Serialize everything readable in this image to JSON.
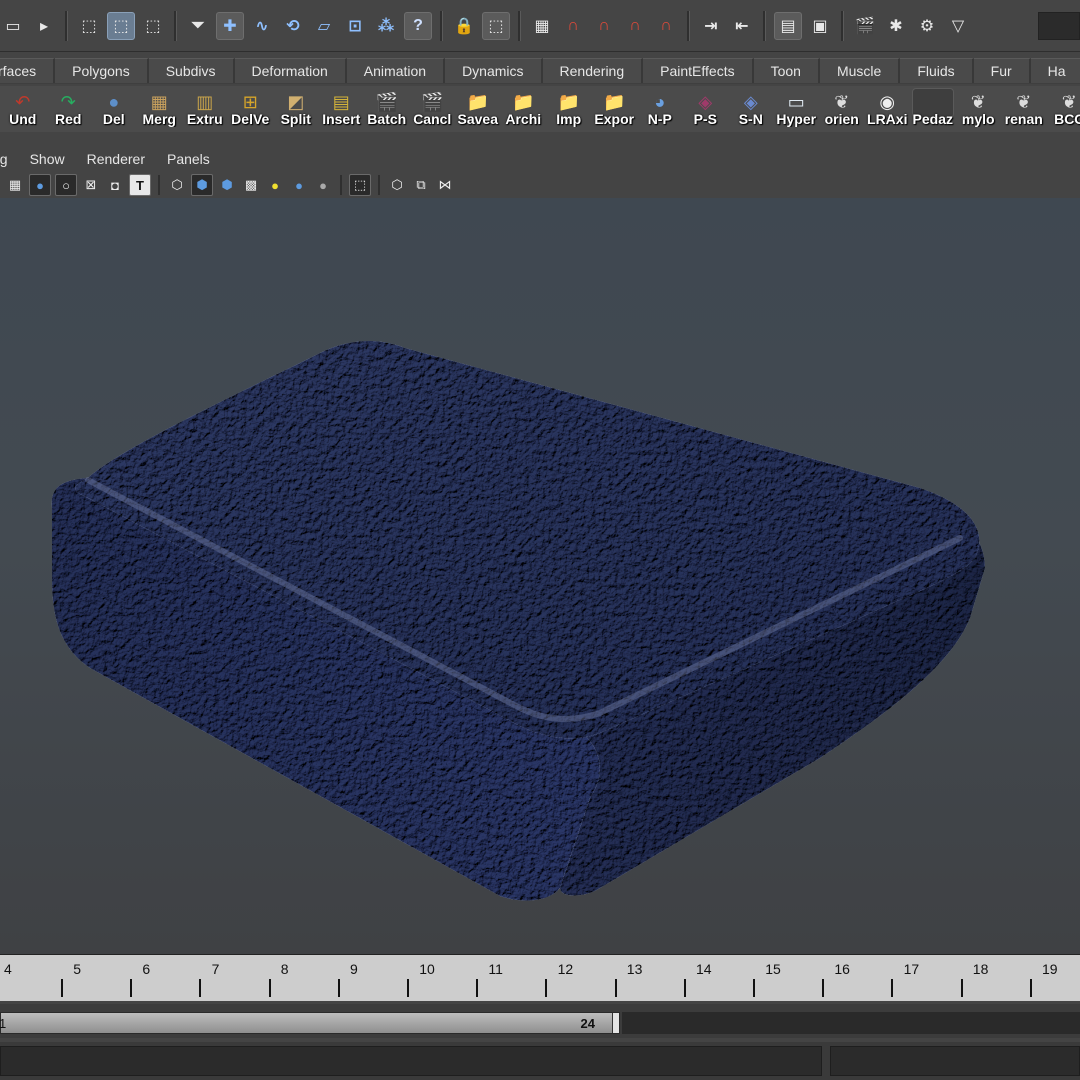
{
  "status_line": {
    "icons": [
      "layout-icon",
      "separator-arrow-icon",
      "select-hierarchy-icon",
      "select-object-icon",
      "select-component-icon",
      "filter-funnel-icon",
      "snap-grid-icon",
      "snap-curve-icon",
      "snap-point-icon",
      "snap-plane-icon",
      "snap-surface-icon",
      "snap-live-icon",
      "help-icon",
      "lock-icon",
      "select-by-type-icon",
      "history-icon",
      "magnet-a-icon",
      "magnet-b-icon",
      "magnet-c-icon",
      "magnet-d-icon",
      "input-ops-icon",
      "output-ops-icon",
      "show-attribute-editor-icon",
      "render-frame-icon",
      "clapboard-icon",
      "ipr-icon",
      "render-settings-icon",
      "expand-icon",
      "input-box-icon"
    ],
    "help_glyph": "?"
  },
  "shelf_tabs": [
    "rfaces",
    "Polygons",
    "Subdivs",
    "Deformation",
    "Animation",
    "Dynamics",
    "Rendering",
    "PaintEffects",
    "Toon",
    "Muscle",
    "Fluids",
    "Fur",
    "Ha"
  ],
  "shelf_buttons": [
    {
      "label": "Und",
      "icon": "undo-arrow-icon",
      "color": "#c0392b"
    },
    {
      "label": "Red",
      "icon": "redo-arrow-icon",
      "color": "#27ae60"
    },
    {
      "label": "Del",
      "icon": "sphere-icon",
      "color": "#5d8fc9"
    },
    {
      "label": "Merg",
      "icon": "merge-mesh-icon",
      "color": "#c9a15d"
    },
    {
      "label": "Extru",
      "icon": "extrude-icon",
      "color": "#caa54b"
    },
    {
      "label": "DelVe",
      "icon": "delete-vertex-icon",
      "color": "#d6a52a"
    },
    {
      "label": "Split",
      "icon": "split-polygon-icon",
      "color": "#d1b070"
    },
    {
      "label": "Insert",
      "icon": "insert-edge-icon",
      "color": "#d3b33a"
    },
    {
      "label": "Batch",
      "icon": "clapboard-icon",
      "color": "#bbbbbb"
    },
    {
      "label": "Cancl",
      "icon": "clapboard-icon",
      "color": "#bbbbbb"
    },
    {
      "label": "Savea",
      "icon": "folder-icon",
      "color": "#e6b93a"
    },
    {
      "label": "Archi",
      "icon": "folder-icon",
      "color": "#e6b93a"
    },
    {
      "label": "Imp",
      "icon": "folder-icon",
      "color": "#e6b93a"
    },
    {
      "label": "Expor",
      "icon": "folder-icon",
      "color": "#e6b93a"
    },
    {
      "label": "N-P",
      "icon": "sphere-globe-icon",
      "color": "#6aa0e0"
    },
    {
      "label": "P-S",
      "icon": "globe-cube-icon",
      "color": "#a03a6a"
    },
    {
      "label": "S-N",
      "icon": "cube-globe-icon",
      "color": "#6a8ad0"
    },
    {
      "label": "Hyper",
      "icon": "hypershade-window-icon",
      "color": "#dfe8f0"
    },
    {
      "label": "orien",
      "icon": "mel-script-icon",
      "color": "#dddddd"
    },
    {
      "label": "LRAxi",
      "icon": "eye-icon",
      "color": "#eeeeee"
    },
    {
      "label": "Pedaz",
      "icon": "blank-icon",
      "color": "#4b4b4b"
    },
    {
      "label": "mylo",
      "icon": "mel-script-icon",
      "color": "#dddddd"
    },
    {
      "label": "renan",
      "icon": "mel-script-icon",
      "color": "#dddddd"
    },
    {
      "label": "BCC",
      "icon": "mel-script-icon",
      "color": "#dddddd"
    }
  ],
  "panel_menu": [
    "ng",
    "Show",
    "Renderer",
    "Panels"
  ],
  "panel_toolbar": {
    "icons": [
      "film-gate-icon",
      "shaded-sphere-icon",
      "wireframe-sphere-icon",
      "grid-toggle-icon",
      "texture-icon",
      "text-icon",
      "wireframe-cube-icon",
      "smooth-shade-cube-icon",
      "flat-shade-cube-icon",
      "checker-cube-icon",
      "default-light-icon",
      "sphere-light-icon",
      "grey-sphere-icon",
      "isolate-select-icon",
      "bounding-box-icon",
      "xray-icon",
      "share-icon"
    ],
    "text_glyph": "T"
  },
  "viewport": {
    "object": "textured-rounded-box-mesh",
    "mesh_color": "#4f5a7c"
  },
  "time_slider": {
    "frames": [
      "4",
      "5",
      "6",
      "7",
      "8",
      "9",
      "10",
      "11",
      "12",
      "13",
      "14",
      "15",
      "16",
      "17",
      "18",
      "19"
    ]
  },
  "range_slider": {
    "start": "1",
    "end": "24"
  },
  "command_line": {
    "input": "",
    "result": ""
  }
}
